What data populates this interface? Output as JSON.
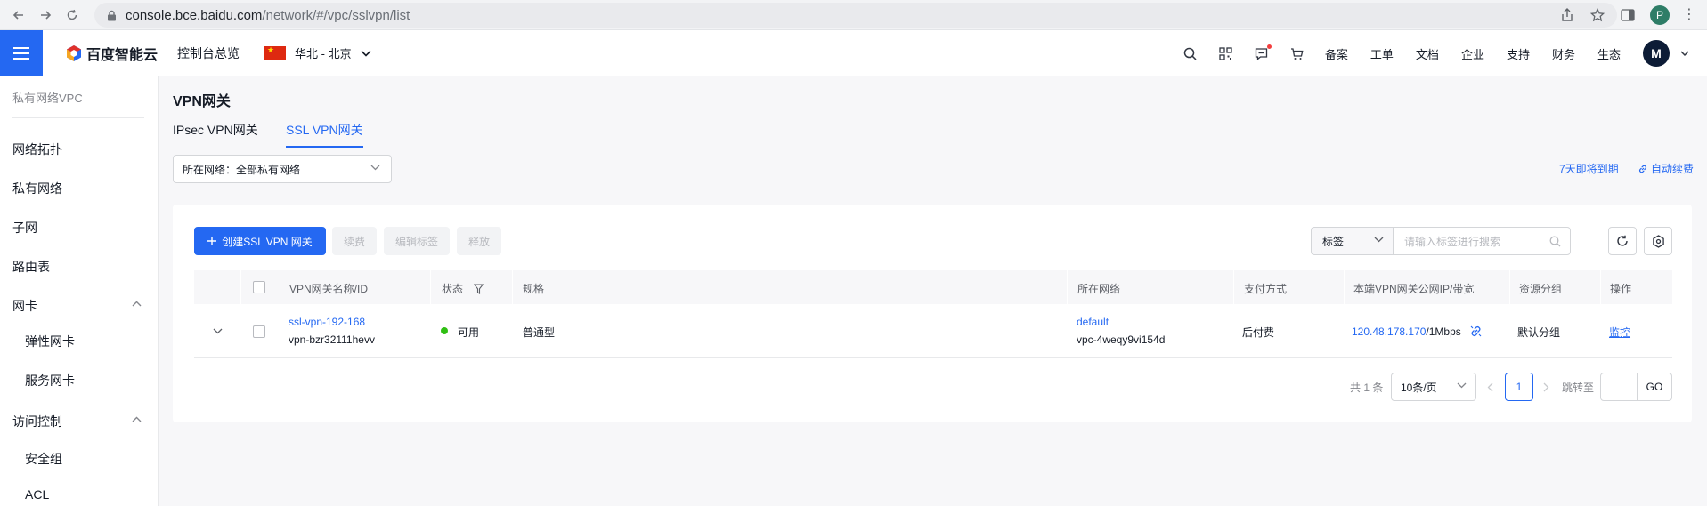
{
  "browser": {
    "url_host": "console.bce.baidu.com",
    "url_path": "/network/#/vpc/sslvpn/list",
    "profile_initial": "P"
  },
  "header": {
    "logo_text": "百度智能云",
    "console_home": "控制台总览",
    "region": "华北 - 北京",
    "links": [
      "备案",
      "工单",
      "文档",
      "企业",
      "支持",
      "财务",
      "生态"
    ],
    "avatar_initial": "M"
  },
  "sidebar": {
    "title": "私有网络VPC",
    "items": [
      "网络拓扑",
      "私有网络",
      "子网",
      "路由表",
      "网卡"
    ],
    "nic_sub": [
      "弹性网卡",
      "服务网卡"
    ],
    "access_control": "访问控制",
    "access_sub": [
      "安全组",
      "ACL"
    ]
  },
  "main": {
    "title": "VPN网关",
    "tabs": [
      "IPsec VPN网关",
      "SSL VPN网关"
    ],
    "active_tab": 1,
    "network_filter_label": "所在网络：",
    "network_filter_value": "全部私有网络",
    "expiring_link": "7天即将到期",
    "auto_renew_link": "自动续费"
  },
  "toolbar": {
    "create_label": "创建SSL VPN 网关",
    "renew_label": "续费",
    "edit_tags_label": "编辑标签",
    "release_label": "释放",
    "tag_select": "标签",
    "search_placeholder": "请输入标签进行搜索"
  },
  "table": {
    "columns": [
      "VPN网关名称/ID",
      "状态",
      "规格",
      "所在网络",
      "支付方式",
      "本端VPN网关公网IP/带宽",
      "资源分组",
      "操作"
    ],
    "rows": [
      {
        "name": "ssl-vpn-192-168",
        "id": "vpn-bzr32111hevv",
        "status": "可用",
        "spec": "普通型",
        "network_name": "default",
        "network_id": "vpc-4weqy9vi154d",
        "payment": "后付费",
        "ip": "120.48.178.170",
        "bandwidth": "/1Mbps",
        "group": "默认分组",
        "action": "监控"
      }
    ]
  },
  "pagination": {
    "total": "共 1 条",
    "page_size": "10条/页",
    "current_page": "1",
    "jump_label": "跳转至",
    "go_label": "GO"
  },
  "colors": {
    "accent": "#2468f2",
    "status_available": "#30bf13"
  }
}
